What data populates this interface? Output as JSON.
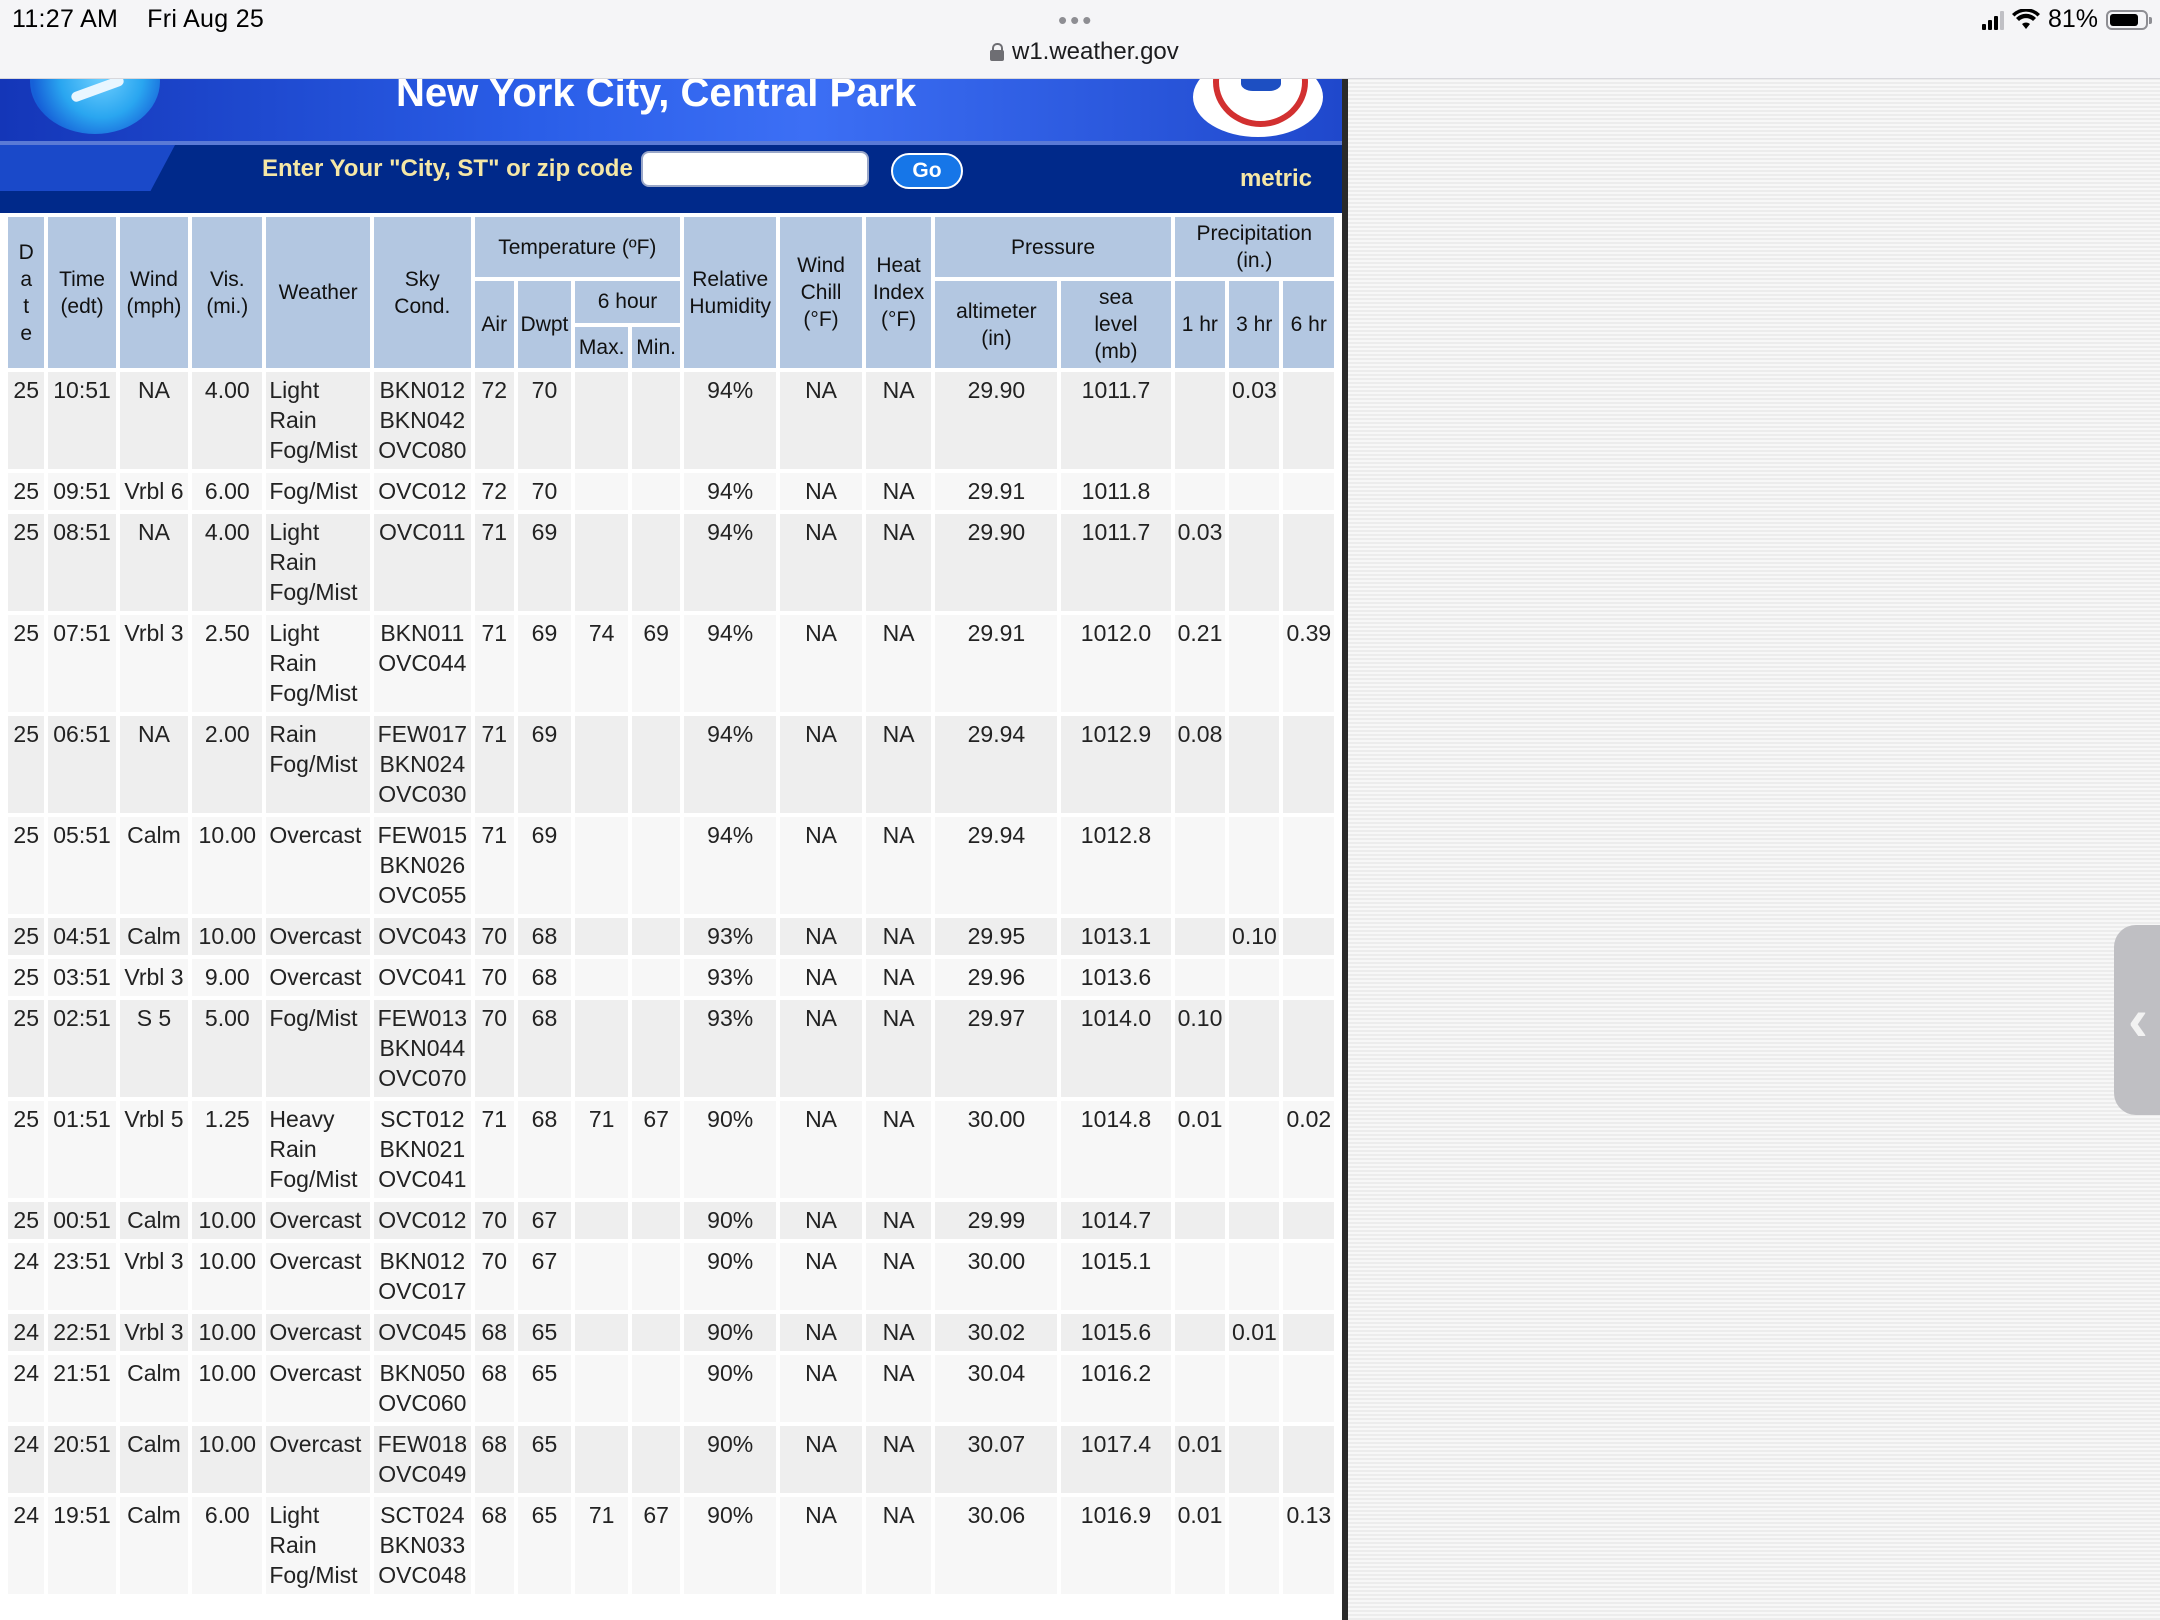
{
  "status": {
    "time": "11:27 AM",
    "day": "Fri Aug 25",
    "url": "w1.weather.gov",
    "battery": "81%",
    "battery_level": 0.81
  },
  "banner": {
    "title": "New York City, Central Park"
  },
  "search": {
    "label": "Enter Your \"City, ST\" or zip code",
    "value": "",
    "go_label": "Go",
    "metric_label": "metric"
  },
  "table": {
    "headers": {
      "date_letters": [
        "D",
        "a",
        "t",
        "e"
      ],
      "time": [
        "Time",
        "(edt)"
      ],
      "wind": [
        "Wind",
        "(mph)"
      ],
      "vis": [
        "Vis.",
        "(mi.)"
      ],
      "weather": "Weather",
      "sky": [
        "Sky",
        "Cond."
      ],
      "temperature": "Temperature (ºF)",
      "air": "Air",
      "dwpt": "Dwpt",
      "six_hour": "6 hour",
      "max": "Max.",
      "min": "Min.",
      "humidity": [
        "Relative",
        "Humidity"
      ],
      "wind_chill": [
        "Wind",
        "Chill",
        "(°F)"
      ],
      "heat_index": [
        "Heat",
        "Index",
        "(°F)"
      ],
      "pressure": "Pressure",
      "altimeter": [
        "altimeter",
        "(in)"
      ],
      "sea_level": [
        "sea",
        "level",
        "(mb)"
      ],
      "precipitation": "Precipitation (in.)",
      "p1": "1 hr",
      "p3": "3 hr",
      "p6": "6 hr"
    },
    "rows": [
      {
        "date": "25",
        "time": "10:51",
        "wind": "NA",
        "vis": "4.00",
        "weather": [
          "Light",
          "Rain",
          "Fog/Mist"
        ],
        "sky": [
          "BKN012",
          "BKN042",
          "OVC080"
        ],
        "air": "72",
        "dwpt": "70",
        "max": "",
        "min": "",
        "rh": "94%",
        "chill": "NA",
        "heat": "NA",
        "alt": "29.90",
        "sea": "1011.7",
        "p1": "",
        "p3": "0.03",
        "p6": ""
      },
      {
        "date": "25",
        "time": "09:51",
        "wind": "Vrbl 6",
        "vis": "6.00",
        "weather": [
          "Fog/Mist"
        ],
        "sky": [
          "OVC012"
        ],
        "air": "72",
        "dwpt": "70",
        "max": "",
        "min": "",
        "rh": "94%",
        "chill": "NA",
        "heat": "NA",
        "alt": "29.91",
        "sea": "1011.8",
        "p1": "",
        "p3": "",
        "p6": ""
      },
      {
        "date": "25",
        "time": "08:51",
        "wind": "NA",
        "vis": "4.00",
        "weather": [
          "Light",
          "Rain",
          "Fog/Mist"
        ],
        "sky": [
          "OVC011"
        ],
        "air": "71",
        "dwpt": "69",
        "max": "",
        "min": "",
        "rh": "94%",
        "chill": "NA",
        "heat": "NA",
        "alt": "29.90",
        "sea": "1011.7",
        "p1": "0.03",
        "p3": "",
        "p6": ""
      },
      {
        "date": "25",
        "time": "07:51",
        "wind": "Vrbl 3",
        "vis": "2.50",
        "weather": [
          "Light",
          "Rain",
          "Fog/Mist"
        ],
        "sky": [
          "BKN011",
          "OVC044"
        ],
        "air": "71",
        "dwpt": "69",
        "max": "74",
        "min": "69",
        "rh": "94%",
        "chill": "NA",
        "heat": "NA",
        "alt": "29.91",
        "sea": "1012.0",
        "p1": "0.21",
        "p3": "",
        "p6": "0.39"
      },
      {
        "date": "25",
        "time": "06:51",
        "wind": "NA",
        "vis": "2.00",
        "weather": [
          "Rain",
          "Fog/Mist"
        ],
        "sky": [
          "FEW017",
          "BKN024",
          "OVC030"
        ],
        "air": "71",
        "dwpt": "69",
        "max": "",
        "min": "",
        "rh": "94%",
        "chill": "NA",
        "heat": "NA",
        "alt": "29.94",
        "sea": "1012.9",
        "p1": "0.08",
        "p3": "",
        "p6": ""
      },
      {
        "date": "25",
        "time": "05:51",
        "wind": "Calm",
        "vis": "10.00",
        "weather": [
          "Overcast"
        ],
        "sky": [
          "FEW015",
          "BKN026",
          "OVC055"
        ],
        "air": "71",
        "dwpt": "69",
        "max": "",
        "min": "",
        "rh": "94%",
        "chill": "NA",
        "heat": "NA",
        "alt": "29.94",
        "sea": "1012.8",
        "p1": "",
        "p3": "",
        "p6": ""
      },
      {
        "date": "25",
        "time": "04:51",
        "wind": "Calm",
        "vis": "10.00",
        "weather": [
          "Overcast"
        ],
        "sky": [
          "OVC043"
        ],
        "air": "70",
        "dwpt": "68",
        "max": "",
        "min": "",
        "rh": "93%",
        "chill": "NA",
        "heat": "NA",
        "alt": "29.95",
        "sea": "1013.1",
        "p1": "",
        "p3": "0.10",
        "p6": ""
      },
      {
        "date": "25",
        "time": "03:51",
        "wind": "Vrbl 3",
        "vis": "9.00",
        "weather": [
          "Overcast"
        ],
        "sky": [
          "OVC041"
        ],
        "air": "70",
        "dwpt": "68",
        "max": "",
        "min": "",
        "rh": "93%",
        "chill": "NA",
        "heat": "NA",
        "alt": "29.96",
        "sea": "1013.6",
        "p1": "",
        "p3": "",
        "p6": ""
      },
      {
        "date": "25",
        "time": "02:51",
        "wind": "S 5",
        "vis": "5.00",
        "weather": [
          "Fog/Mist"
        ],
        "sky": [
          "FEW013",
          "BKN044",
          "OVC070"
        ],
        "air": "70",
        "dwpt": "68",
        "max": "",
        "min": "",
        "rh": "93%",
        "chill": "NA",
        "heat": "NA",
        "alt": "29.97",
        "sea": "1014.0",
        "p1": "0.10",
        "p3": "",
        "p6": ""
      },
      {
        "date": "25",
        "time": "01:51",
        "wind": "Vrbl 5",
        "vis": "1.25",
        "weather": [
          "Heavy",
          "Rain",
          "Fog/Mist"
        ],
        "sky": [
          "SCT012",
          "BKN021",
          "OVC041"
        ],
        "air": "71",
        "dwpt": "68",
        "max": "71",
        "min": "67",
        "rh": "90%",
        "chill": "NA",
        "heat": "NA",
        "alt": "30.00",
        "sea": "1014.8",
        "p1": "0.01",
        "p3": "",
        "p6": "0.02"
      },
      {
        "date": "25",
        "time": "00:51",
        "wind": "Calm",
        "vis": "10.00",
        "weather": [
          "Overcast"
        ],
        "sky": [
          "OVC012"
        ],
        "air": "70",
        "dwpt": "67",
        "max": "",
        "min": "",
        "rh": "90%",
        "chill": "NA",
        "heat": "NA",
        "alt": "29.99",
        "sea": "1014.7",
        "p1": "",
        "p3": "",
        "p6": ""
      },
      {
        "date": "24",
        "time": "23:51",
        "wind": "Vrbl 3",
        "vis": "10.00",
        "weather": [
          "Overcast"
        ],
        "sky": [
          "BKN012",
          "OVC017"
        ],
        "air": "70",
        "dwpt": "67",
        "max": "",
        "min": "",
        "rh": "90%",
        "chill": "NA",
        "heat": "NA",
        "alt": "30.00",
        "sea": "1015.1",
        "p1": "",
        "p3": "",
        "p6": ""
      },
      {
        "date": "24",
        "time": "22:51",
        "wind": "Vrbl 3",
        "vis": "10.00",
        "weather": [
          "Overcast"
        ],
        "sky": [
          "OVC045"
        ],
        "air": "68",
        "dwpt": "65",
        "max": "",
        "min": "",
        "rh": "90%",
        "chill": "NA",
        "heat": "NA",
        "alt": "30.02",
        "sea": "1015.6",
        "p1": "",
        "p3": "0.01",
        "p6": ""
      },
      {
        "date": "24",
        "time": "21:51",
        "wind": "Calm",
        "vis": "10.00",
        "weather": [
          "Overcast"
        ],
        "sky": [
          "BKN050",
          "OVC060"
        ],
        "air": "68",
        "dwpt": "65",
        "max": "",
        "min": "",
        "rh": "90%",
        "chill": "NA",
        "heat": "NA",
        "alt": "30.04",
        "sea": "1016.2",
        "p1": "",
        "p3": "",
        "p6": ""
      },
      {
        "date": "24",
        "time": "20:51",
        "wind": "Calm",
        "vis": "10.00",
        "weather": [
          "Overcast"
        ],
        "sky": [
          "FEW018",
          "OVC049"
        ],
        "air": "68",
        "dwpt": "65",
        "max": "",
        "min": "",
        "rh": "90%",
        "chill": "NA",
        "heat": "NA",
        "alt": "30.07",
        "sea": "1017.4",
        "p1": "0.01",
        "p3": "",
        "p6": ""
      },
      {
        "date": "24",
        "time": "19:51",
        "wind": "Calm",
        "vis": "6.00",
        "weather": [
          "Light",
          "Rain",
          "Fog/Mist"
        ],
        "sky": [
          "SCT024",
          "BKN033",
          "OVC048"
        ],
        "air": "68",
        "dwpt": "65",
        "max": "71",
        "min": "67",
        "rh": "90%",
        "chill": "NA",
        "heat": "NA",
        "alt": "30.06",
        "sea": "1016.9",
        "p1": "0.01",
        "p3": "",
        "p6": "0.13"
      }
    ]
  }
}
